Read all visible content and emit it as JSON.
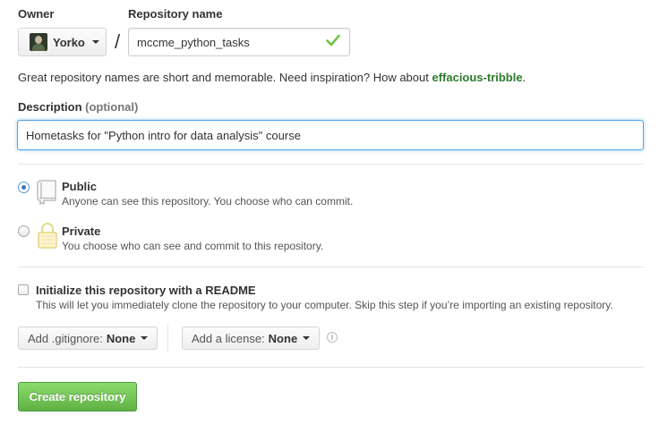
{
  "owner": {
    "label": "Owner",
    "value": "Yorko"
  },
  "repository": {
    "label": "Repository name",
    "value": "mccme_python_tasks"
  },
  "hint": {
    "text": "Great repository names are short and memorable. Need inspiration? How about ",
    "suggestion": "effacious-tribble",
    "end": "."
  },
  "description": {
    "label": "Description",
    "optional": "(optional)",
    "value": "Hometasks for \"Python intro for data analysis\" course"
  },
  "visibility": {
    "selected": "public",
    "public": {
      "title": "Public",
      "desc": "Anyone can see this repository. You choose who can commit."
    },
    "private": {
      "title": "Private",
      "desc": "You choose who can see and commit to this repository."
    }
  },
  "readme": {
    "checked": false,
    "title": "Initialize this repository with a README",
    "desc": "This will let you immediately clone the repository to your computer. Skip this step if you’re importing an existing repository."
  },
  "gitignore": {
    "prefix": "Add .gitignore:",
    "value": "None"
  },
  "license": {
    "prefix": "Add a license:",
    "value": "None"
  },
  "create_button": "Create repository",
  "colors": {
    "success": "#6cc644",
    "accent": "#51a7e8",
    "button_green": "#60b044",
    "suggestion": "#2c7a2c"
  }
}
